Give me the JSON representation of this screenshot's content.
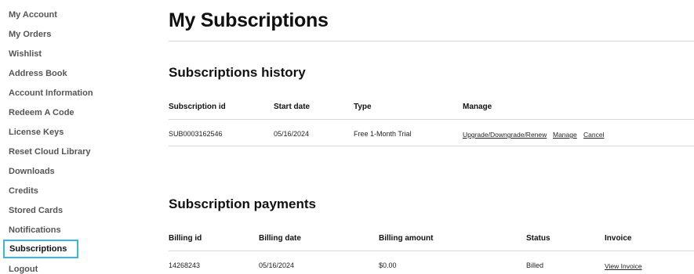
{
  "sidebar": {
    "items": [
      {
        "label": "My Account"
      },
      {
        "label": "My Orders"
      },
      {
        "label": "Wishlist"
      },
      {
        "label": "Address Book"
      },
      {
        "label": "Account Information"
      },
      {
        "label": "Redeem A Code"
      },
      {
        "label": "License Keys"
      },
      {
        "label": "Reset Cloud Library"
      },
      {
        "label": "Downloads"
      },
      {
        "label": "Credits"
      },
      {
        "label": "Stored Cards"
      },
      {
        "label": "Notifications"
      },
      {
        "label": "Subscriptions",
        "active": true
      },
      {
        "label": "Logout"
      }
    ],
    "active_border_color": "#3bb6d9"
  },
  "main": {
    "title": "My Subscriptions",
    "history": {
      "heading": "Subscriptions history",
      "columns": [
        "Subscription id",
        "Start date",
        "Type",
        "Manage"
      ],
      "rows": [
        {
          "id": "SUB0003162546",
          "start_date": "05/16/2024",
          "type": "Free 1-Month Trial",
          "actions": [
            "Upgrade/Downgrade/Renew",
            "Manage",
            "Cancel"
          ]
        }
      ]
    },
    "payments": {
      "heading": "Subscription payments",
      "columns": [
        "Billing id",
        "Billing date",
        "Billing amount",
        "Status",
        "Invoice"
      ],
      "rows": [
        {
          "id": "14268243",
          "date": "05/16/2024",
          "amount": "$0.00",
          "status": "Billed",
          "invoice": "View Invoice"
        }
      ]
    }
  }
}
